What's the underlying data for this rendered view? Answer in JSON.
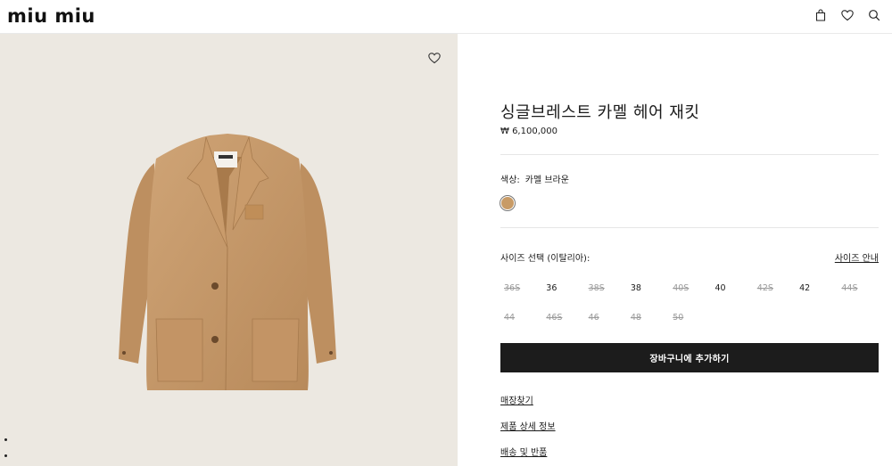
{
  "header": {
    "logo": "miu miu",
    "icons": [
      "bag-icon",
      "heart-icon",
      "search-icon"
    ]
  },
  "hero": {
    "wishlist_icon": "heart-icon",
    "carousel_dots": 2
  },
  "product": {
    "title": "싱글브레스트 카멜 헤어 재킷",
    "price": "₩ 6,100,000",
    "color_label": "색상:",
    "color_value": "카멜 브라운",
    "swatch_color": "#c89b66",
    "size_label": "사이즈 선택 (이탈리아):",
    "size_guide": "사이즈 안내",
    "sizes": [
      {
        "label": "36S",
        "available": false
      },
      {
        "label": "36",
        "available": true
      },
      {
        "label": "38S",
        "available": false
      },
      {
        "label": "38",
        "available": true
      },
      {
        "label": "40S",
        "available": false
      },
      {
        "label": "40",
        "available": true
      },
      {
        "label": "42S",
        "available": false
      },
      {
        "label": "42",
        "available": true
      },
      {
        "label": "44S",
        "available": false
      },
      {
        "label": "44",
        "available": false
      },
      {
        "label": "46S",
        "available": false
      },
      {
        "label": "46",
        "available": false
      },
      {
        "label": "48",
        "available": false
      },
      {
        "label": "50",
        "available": false
      }
    ],
    "add_to_cart": "장바구니에 추가하기",
    "links": [
      "매장찾기",
      "제품 상세 정보",
      "배송 및 반품"
    ]
  },
  "colors": {
    "hero_bg": "#ece8e1",
    "button_bg": "#1c1c1c",
    "jacket": "#c49a6c"
  }
}
